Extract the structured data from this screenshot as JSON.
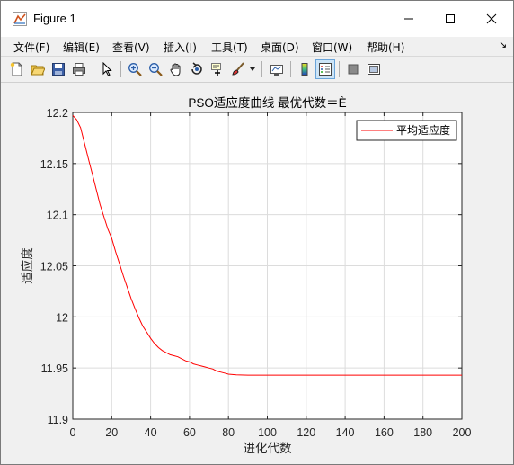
{
  "window": {
    "title": "Figure 1",
    "controls": {
      "minimize": "─",
      "maximize": "☐",
      "close": "✕"
    }
  },
  "menu": {
    "items": [
      "文件(F)",
      "编辑(E)",
      "查看(V)",
      "插入(I)",
      "工具(T)",
      "桌面(D)",
      "窗口(W)",
      "帮助(H)"
    ],
    "dock_arrow": "↘"
  },
  "toolbar": {
    "icons": [
      "new-figure-icon",
      "open-file-icon",
      "save-icon",
      "print-icon",
      "edit-plot-arrow-icon",
      "zoom-in-icon",
      "zoom-out-icon",
      "pan-hand-icon",
      "rotate-3d-icon",
      "data-cursor-icon",
      "brush-icon",
      "brush-dropdown-icon",
      "link-plot-icon",
      "colorbar-icon",
      "legend-icon",
      "hide-plot-tools-icon",
      "show-plot-tools-icon"
    ],
    "active": "legend-icon"
  },
  "chart_data": {
    "type": "line",
    "title": "PSO适应度曲线  最优代数＝È",
    "xlabel": "进化代数",
    "ylabel": "适应度",
    "xlim": [
      0,
      200
    ],
    "ylim": [
      11.9,
      12.2
    ],
    "xticks": [
      0,
      20,
      40,
      60,
      80,
      100,
      120,
      140,
      160,
      180,
      200
    ],
    "yticks": [
      11.9,
      11.95,
      12,
      12.05,
      12.1,
      12.15,
      12.2
    ],
    "ytick_labels": [
      "11.9",
      "11.95",
      "12",
      "12.05",
      "12.1",
      "12.15",
      "12.2"
    ],
    "grid": true,
    "legend_position": "top-right",
    "series": [
      {
        "name": "平均适应度",
        "color": "#ff0000",
        "x": [
          0,
          2,
          4,
          6,
          8,
          10,
          12,
          14,
          16,
          18,
          20,
          22,
          24,
          26,
          28,
          30,
          32,
          34,
          36,
          38,
          40,
          42,
          44,
          46,
          48,
          50,
          52,
          54,
          56,
          58,
          60,
          62,
          64,
          66,
          68,
          70,
          72,
          74,
          76,
          78,
          80,
          84,
          90,
          100,
          120,
          140,
          160,
          180,
          200
        ],
        "y": [
          12.197,
          12.193,
          12.185,
          12.17,
          12.155,
          12.14,
          12.125,
          12.11,
          12.098,
          12.086,
          12.077,
          12.064,
          12.052,
          12.04,
          12.029,
          12.018,
          12.008,
          11.999,
          11.991,
          11.985,
          11.979,
          11.974,
          11.97,
          11.967,
          11.965,
          11.963,
          11.962,
          11.961,
          11.959,
          11.957,
          11.956,
          11.954,
          11.953,
          11.952,
          11.951,
          11.95,
          11.949,
          11.947,
          11.946,
          11.945,
          11.944,
          11.9433,
          11.943,
          11.943,
          11.943,
          11.943,
          11.943,
          11.943,
          11.943
        ]
      }
    ]
  }
}
